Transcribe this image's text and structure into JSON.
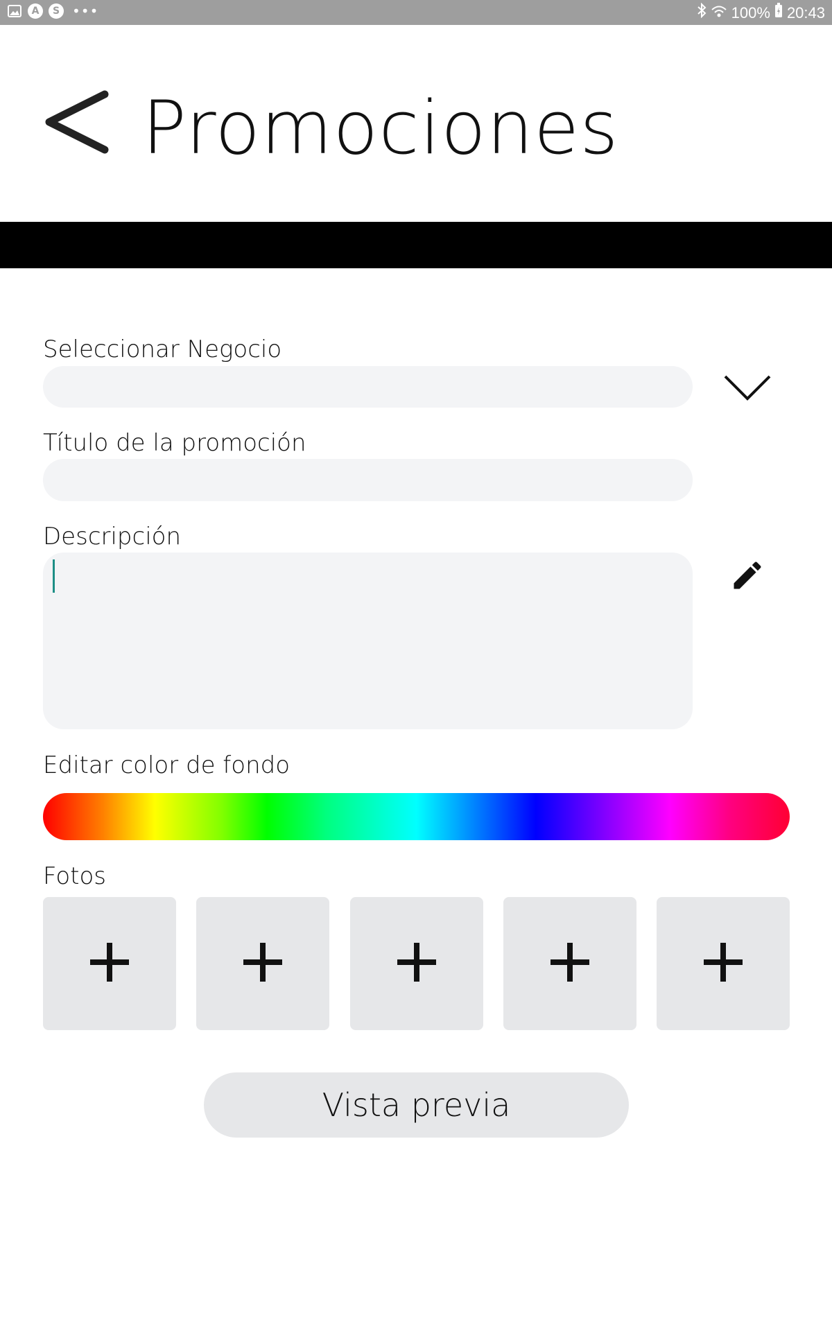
{
  "status_bar": {
    "left_icons": [
      "image-icon",
      "a-circle-icon",
      "s-circle-icon",
      "more-dots-icon"
    ],
    "a_glyph": "A",
    "s_glyph": "S",
    "dots": "•••",
    "battery": "100%",
    "time": "20:43"
  },
  "header": {
    "back_icon": "chevron-left-icon",
    "title": "Promociones"
  },
  "form": {
    "business": {
      "label": "Seleccionar Negocio",
      "value": "",
      "icon": "chevron-down-icon"
    },
    "promo_title": {
      "label": "Título de la promoción",
      "value": ""
    },
    "description": {
      "label": "Descripción",
      "value": "",
      "icon": "pencil-icon"
    },
    "background_color": {
      "label": "Editar color de fondo"
    },
    "photos": {
      "label": "Fotos",
      "slots": [
        {
          "glyph": "+"
        },
        {
          "glyph": "+"
        },
        {
          "glyph": "+"
        },
        {
          "glyph": "+"
        },
        {
          "glyph": "+"
        }
      ]
    }
  },
  "actions": {
    "preview_label": "Vista previa"
  },
  "colors": {
    "status_bar": "#9e9e9e",
    "band": "#000000",
    "field_bg": "#f3f4f6",
    "button_bg": "#e6e7e9",
    "caret": "#1d8f86"
  }
}
